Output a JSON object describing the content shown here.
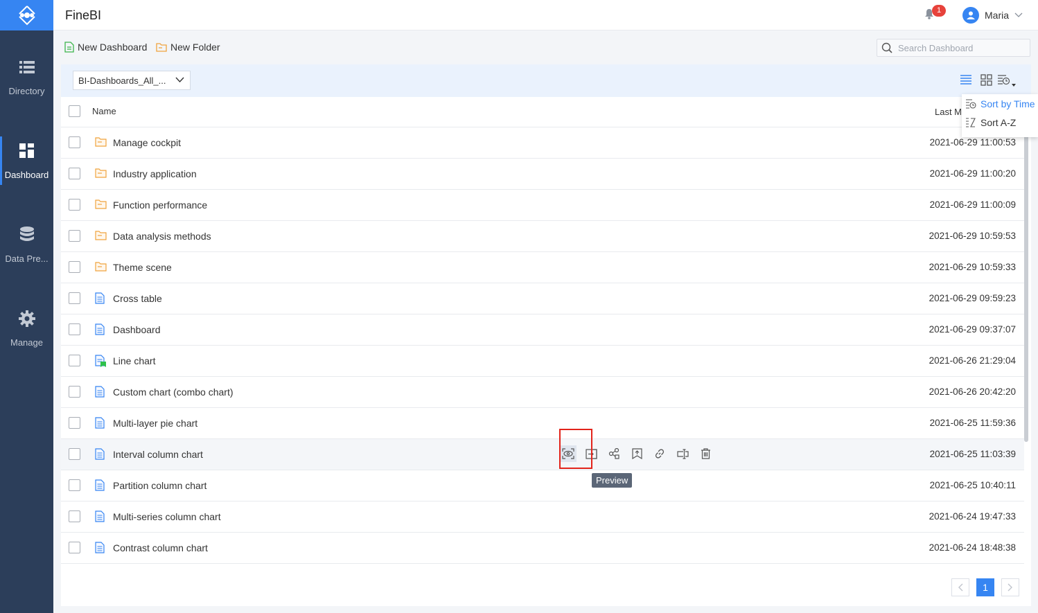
{
  "app": {
    "title": "FineBI"
  },
  "sidebar": {
    "items": [
      {
        "label": "Directory",
        "icon": "list-icon",
        "active": false
      },
      {
        "label": "Dashboard",
        "icon": "dashboard-icon",
        "active": true
      },
      {
        "label": "Data Pre...",
        "icon": "database-icon",
        "active": false
      },
      {
        "label": "Manage",
        "icon": "gear-icon",
        "active": false
      }
    ]
  },
  "header": {
    "notification_count": "1",
    "user_name": "Maria"
  },
  "toolbar": {
    "new_dashboard_label": "New Dashboard",
    "new_folder_label": "New Folder",
    "search_placeholder": "Search Dashboard"
  },
  "filter": {
    "folder_selected": "BI-Dashboards_All_..."
  },
  "table": {
    "col_name": "Name",
    "col_last_modified": "Last M",
    "rows": [
      {
        "name": "Manage cockpit",
        "time": "2021-06-29 11:00:53",
        "type": "folder"
      },
      {
        "name": "Industry application",
        "time": "2021-06-29 11:00:20",
        "type": "folder"
      },
      {
        "name": "Function performance",
        "time": "2021-06-29 11:00:09",
        "type": "folder"
      },
      {
        "name": "Data analysis methods",
        "time": "2021-06-29 10:59:53",
        "type": "folder"
      },
      {
        "name": "Theme scene",
        "time": "2021-06-29 10:59:33",
        "type": "folder"
      },
      {
        "name": "Cross table",
        "time": "2021-06-29 09:59:23",
        "type": "doc"
      },
      {
        "name": "Dashboard",
        "time": "2021-06-29 09:37:07",
        "type": "doc"
      },
      {
        "name": "Line chart",
        "time": "2021-06-26 21:29:04",
        "type": "doc-flag"
      },
      {
        "name": "Custom chart (combo chart)",
        "time": "2021-06-26 20:42:20",
        "type": "doc"
      },
      {
        "name": "Multi-layer pie chart",
        "time": "2021-06-25 11:59:36",
        "type": "doc"
      },
      {
        "name": "Interval column chart",
        "time": "2021-06-25 11:03:39",
        "type": "doc"
      },
      {
        "name": "Partition column chart",
        "time": "2021-06-25 10:40:11",
        "type": "doc"
      },
      {
        "name": "Multi-series column chart",
        "time": "2021-06-24 19:47:33",
        "type": "doc"
      },
      {
        "name": "Contrast column chart",
        "time": "2021-06-24 18:48:38",
        "type": "doc"
      }
    ]
  },
  "row_actions": {
    "icons": [
      "preview-icon",
      "move-icon",
      "share-icon",
      "publish-icon",
      "link-icon",
      "rename-icon",
      "delete-icon"
    ],
    "tooltip": "Preview"
  },
  "sort_menu": {
    "by_time": "Sort by Time",
    "a_z": "Sort A-Z"
  },
  "pagination": {
    "current": "1"
  },
  "colors": {
    "accent": "#3685f2",
    "sidebar": "#2c3e5a",
    "folder": "#f0a33d",
    "doc": "#3685f2",
    "badge": "#e7423b",
    "highlight": "#e2231a"
  }
}
